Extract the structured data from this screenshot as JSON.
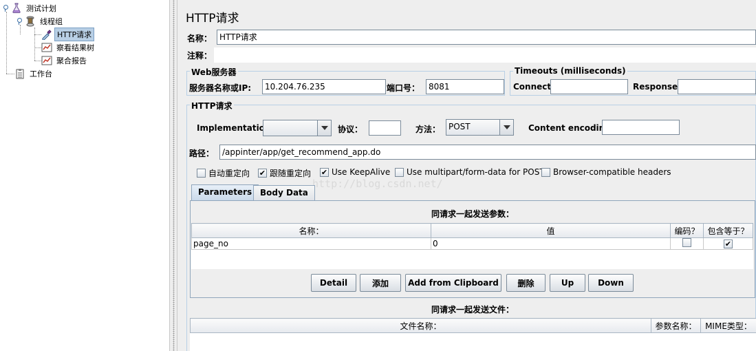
{
  "tree": {
    "items": [
      {
        "label": "测试计划",
        "icon": "flask-icon"
      },
      {
        "label": "线程组",
        "icon": "spool-icon"
      },
      {
        "label": "HTTP请求",
        "icon": "dropper-icon"
      },
      {
        "label": "察看结果树",
        "icon": "chart-icon"
      },
      {
        "label": "聚合报告",
        "icon": "chart-icon"
      },
      {
        "label": "工作台",
        "icon": "clipboard-icon"
      }
    ]
  },
  "main": {
    "title": "HTTP请求",
    "name_label": "名称：",
    "name_value": "HTTP请求",
    "comment_label": "注释：",
    "comment_value": "",
    "web_server": {
      "title": "Web服务器",
      "server_label": "服务器名称或IP:",
      "server_value": "10.204.76.235",
      "port_label": "端口号：",
      "port_value": "8081"
    },
    "timeouts": {
      "title": "Timeouts (milliseconds)",
      "connect_label": "Connect:",
      "connect_value": "",
      "response_label": "Response:",
      "response_value": ""
    },
    "http_request": {
      "title": "HTTP请求",
      "implementation_label": "Implementation:",
      "implementation_value": "",
      "protocol_label": "协议：",
      "protocol_value": "",
      "method_label": "方法：",
      "method_value": "POST",
      "encoding_label": "Content encoding:",
      "encoding_value": "",
      "path_label": "路径：",
      "path_value": "/appinter/app/get_recommend_app.do"
    },
    "options": [
      {
        "label": "自动重定向",
        "checked": false
      },
      {
        "label": "跟随重定向",
        "checked": true
      },
      {
        "label": "Use KeepAlive",
        "checked": true
      },
      {
        "label": "Use multipart/form-data for POST",
        "checked": false
      },
      {
        "label": "Browser-compatible headers",
        "checked": false
      }
    ],
    "watermark": "http://blog.csdn.net/",
    "tabs": [
      {
        "label": "Parameters",
        "active": true
      },
      {
        "label": "Body Data",
        "active": false
      }
    ],
    "params": {
      "caption": "同请求一起发送参数：",
      "headers": [
        "名称：",
        "值",
        "编码？",
        "包含等于？"
      ],
      "rows": [
        {
          "name": "page_no",
          "value": "0",
          "encode": false,
          "include_equals": true
        }
      ]
    },
    "buttons": [
      "Detail",
      "添加",
      "Add from Clipboard",
      "删除",
      "Up",
      "Down"
    ],
    "files": {
      "caption": "同请求一起发送文件：",
      "headers": [
        "文件名称：",
        "参数名称：",
        "MIME类型："
      ]
    },
    "check_mark": "✔"
  }
}
